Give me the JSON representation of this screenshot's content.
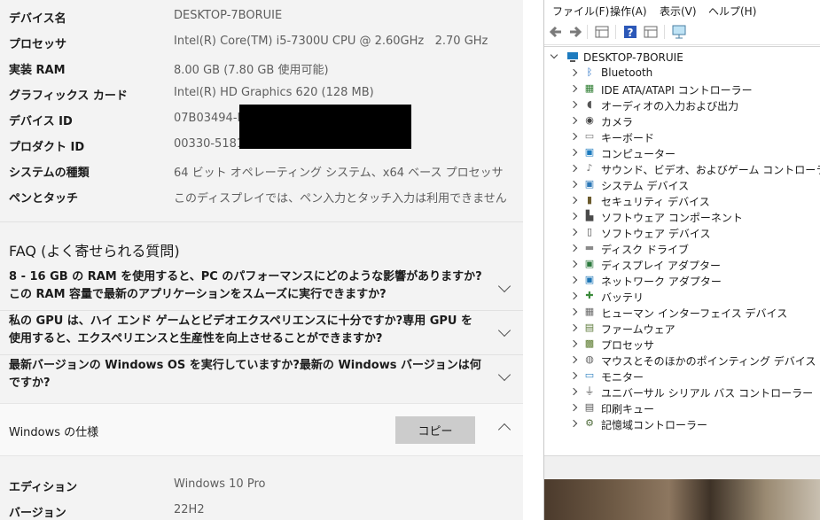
{
  "device_specs": [
    {
      "key": "デバイス名",
      "value": "DESKTOP-7BORUIE"
    },
    {
      "key": "プロセッサ",
      "value": "Intel(R) Core(TM) i5-7300U CPU @ 2.60GHz   2.70 GHz"
    },
    {
      "key": "実装 RAM",
      "value": "8.00 GB (7.80 GB 使用可能)"
    },
    {
      "key": "グラフィックス カード",
      "value": "Intel(R) HD Graphics 620 (128 MB)"
    },
    {
      "key": "デバイス ID",
      "value": "07B03494-D"
    },
    {
      "key": "プロダクト ID",
      "value": "00330-5181"
    },
    {
      "key": "システムの種類",
      "value": "64 ビット オペレーティング システム、x64 ベース プロセッサ"
    },
    {
      "key": "ペンとタッチ",
      "value": "このディスプレイでは、ペン入力とタッチ入力は利用できません"
    }
  ],
  "faq": {
    "title": "FAQ (よく寄せられる質問)",
    "items": [
      "8 - 16 GB の RAM を使用すると、PC のパフォーマンスにどのような影響がありますか?この RAM 容量で最新のアプリケーションをスムーズに実行できますか?",
      "私の GPU は、ハイ エンド ゲームとビデオエクスペリエンスに十分ですか?専用 GPU を使用すると、エクスペリエンスと生産性を向上させることができますか?",
      "最新バージョンの Windows OS を実行していますか?最新の Windows バージョンは何ですか?"
    ]
  },
  "windows_spec": {
    "title": "Windows の仕様",
    "copy_label": "コピー",
    "rows": [
      {
        "key": "エディション",
        "value": "Windows 10 Pro"
      },
      {
        "key": "バージョン",
        "value": "22H2"
      }
    ]
  },
  "device_manager": {
    "menu": [
      "ファイル(F)",
      "操作(A)",
      "表示(V)",
      "ヘルプ(H)"
    ],
    "root": "DESKTOP-7BORUIE",
    "nodes": [
      {
        "label": "Bluetooth",
        "icon": "bluetooth-icon"
      },
      {
        "label": "IDE ATA/ATAPI コントローラー",
        "icon": "ide-controller-icon"
      },
      {
        "label": "オーディオの入力および出力",
        "icon": "speaker-icon"
      },
      {
        "label": "カメラ",
        "icon": "camera-icon"
      },
      {
        "label": "キーボード",
        "icon": "keyboard-icon"
      },
      {
        "label": "コンピューター",
        "icon": "computer-icon"
      },
      {
        "label": "サウンド、ビデオ、およびゲーム コントローラー",
        "icon": "sound-icon"
      },
      {
        "label": "システム デバイス",
        "icon": "system-device-icon"
      },
      {
        "label": "セキュリティ デバイス",
        "icon": "security-device-icon"
      },
      {
        "label": "ソフトウェア コンポーネント",
        "icon": "software-component-icon"
      },
      {
        "label": "ソフトウェア デバイス",
        "icon": "software-device-icon"
      },
      {
        "label": "ディスク ドライブ",
        "icon": "disk-drive-icon"
      },
      {
        "label": "ディスプレイ アダプター",
        "icon": "display-adapter-icon"
      },
      {
        "label": "ネットワーク アダプター",
        "icon": "network-adapter-icon"
      },
      {
        "label": "バッテリ",
        "icon": "battery-icon"
      },
      {
        "label": "ヒューマン インターフェイス デバイス",
        "icon": "hid-icon"
      },
      {
        "label": "ファームウェア",
        "icon": "firmware-icon"
      },
      {
        "label": "プロセッサ",
        "icon": "processor-icon"
      },
      {
        "label": "マウスとそのほかのポインティング デバイス",
        "icon": "mouse-icon"
      },
      {
        "label": "モニター",
        "icon": "monitor-icon"
      },
      {
        "label": "ユニバーサル シリアル バス コントローラー",
        "icon": "usb-icon"
      },
      {
        "label": "印刷キュー",
        "icon": "printer-icon"
      },
      {
        "label": "記憶域コントローラー",
        "icon": "storage-controller-icon"
      }
    ]
  },
  "colors": {
    "accent": "#0078d4",
    "copy_button_bg": "#cccccc",
    "redaction": "#000000"
  }
}
